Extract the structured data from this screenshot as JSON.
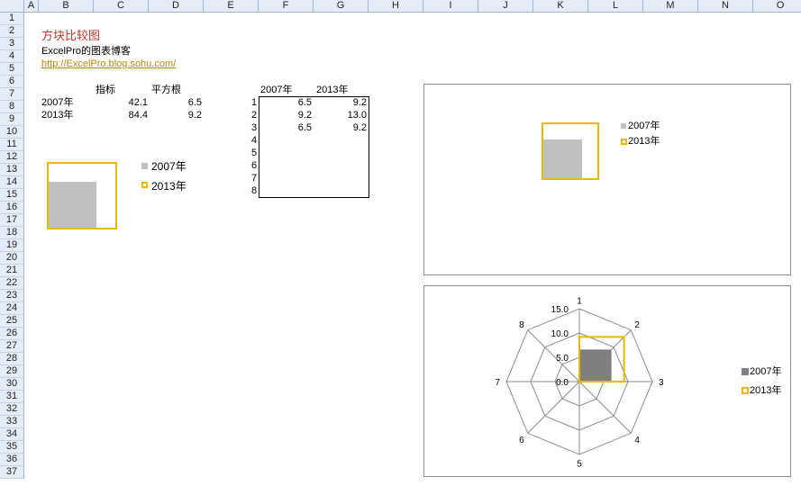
{
  "columns": [
    "A",
    "B",
    "C",
    "D",
    "E",
    "F",
    "G",
    "H",
    "I",
    "J",
    "K",
    "L",
    "M",
    "N",
    "O"
  ],
  "rows": [
    "1",
    "2",
    "3",
    "4",
    "5",
    "6",
    "7",
    "8",
    "9",
    "10",
    "11",
    "12",
    "13",
    "14",
    "15",
    "16",
    "17",
    "18",
    "19",
    "20",
    "21",
    "22",
    "23",
    "24",
    "25",
    "26",
    "27",
    "28",
    "29",
    "30",
    "31",
    "32",
    "33",
    "34",
    "35",
    "36",
    "37"
  ],
  "header": {
    "title": "方块比较图",
    "subtitle": "ExcelPro的图表博客",
    "link": "http://ExcelPro.blog.sohu.com/"
  },
  "table1": {
    "head_metric": "指标",
    "head_sqrt": "平方根",
    "rows": [
      {
        "label": "2007年",
        "metric": "42.1",
        "sqrt": "6.5"
      },
      {
        "label": "2013年",
        "metric": "84.4",
        "sqrt": "9.2"
      }
    ]
  },
  "table2": {
    "head_2007": "2007年",
    "head_2013": "2013年",
    "index": [
      "1",
      "2",
      "3",
      "4",
      "5",
      "6",
      "7",
      "8"
    ],
    "v2007": [
      "6.5",
      "9.2",
      "6.5",
      "",
      "",
      "",
      "",
      ""
    ],
    "v2013": [
      "9.2",
      "13.0",
      "9.2",
      "",
      "",
      "",
      "",
      ""
    ]
  },
  "legend": {
    "s2007": "2007年",
    "s2013": "2013年"
  },
  "colors": {
    "gray": "#bfbfbf",
    "dark": "#7f7f7f",
    "gold": "#e6b800",
    "grid": "#d4d4d4",
    "header_bg": "#e4ecf7"
  },
  "chart_data": {
    "type": "radar",
    "categories": [
      "1",
      "2",
      "3",
      "4",
      "5",
      "6",
      "7",
      "8"
    ],
    "series": [
      {
        "name": "2007年",
        "values": [
          6.5,
          9.2,
          6.5,
          0,
          0,
          0,
          0,
          0
        ]
      },
      {
        "name": "2013年",
        "values": [
          9.2,
          13.0,
          9.2,
          0,
          0,
          0,
          0,
          0
        ]
      }
    ],
    "r_ticks": [
      "0.0",
      "5.0",
      "10.0",
      "15.0"
    ],
    "rlim": [
      0,
      15
    ],
    "legend": "right"
  }
}
